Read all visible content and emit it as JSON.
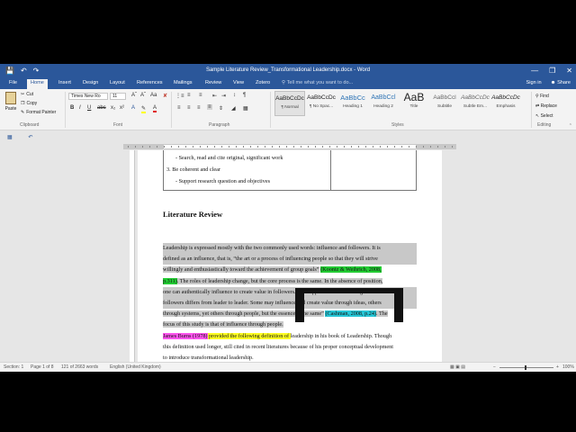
{
  "window": {
    "title": "Sample Literature Review_Transformational Leadership.docx - Word",
    "buttons": [
      "—",
      "❐",
      "✕"
    ]
  },
  "qat": {
    "save": "💾",
    "undo": "↶",
    "redo": "↷"
  },
  "tabs": [
    "File",
    "Home",
    "Insert",
    "Design",
    "Layout",
    "References",
    "Mailings",
    "Review",
    "View",
    "Zotero"
  ],
  "tell_me": "Tell me what you want to do...",
  "account": {
    "signin": "Sign in",
    "share": "Share"
  },
  "ribbon": {
    "clipboard": {
      "paste": "Paste",
      "cut": "Cut",
      "copy": "Copy",
      "format_painter": "Format Painter",
      "label": "Clipboard"
    },
    "font": {
      "name": "Times New Ro",
      "size": "11",
      "label": "Font"
    },
    "paragraph": {
      "label": "Paragraph"
    },
    "styles": {
      "label": "Styles",
      "items": [
        {
          "sample": "AaBbCcDc",
          "name": "¶ Normal"
        },
        {
          "sample": "AaBbCcDc",
          "name": "¶ No Spac..."
        },
        {
          "sample": "AaBbCc",
          "name": "Heading 1"
        },
        {
          "sample": "AaBbCcl",
          "name": "Heading 2"
        },
        {
          "sample": "AaB",
          "name": "Title"
        },
        {
          "sample": "AaBbCcl",
          "name": "Subtitle"
        },
        {
          "sample": "AaBbCcDc",
          "name": "Subtle Em..."
        },
        {
          "sample": "AaBbCcDc",
          "name": "Emphasis"
        }
      ]
    },
    "editing": {
      "find": "Find",
      "replace": "Replace",
      "select": "Select",
      "label": "Editing"
    }
  },
  "document": {
    "table_lines": [
      "- Search, read and cite original, significant work",
      "3.  Be coherent and clear",
      "- Support research question and objectives"
    ],
    "heading": "Literature Review",
    "para1": {
      "l1": "Leadership is expressed mostly with the two commonly used words: influence and followers. It is",
      "l2": "defined as an influence, that is, “the art or a process of influencing people so that they will strive",
      "l3a": "willingly and enthusiastically toward the achievement of group goals”",
      "l3b": "(Koontz & Weihrich, 2008,",
      "l4a": "p.311)",
      "l4b": ". The roles of leadership change, but the core process is the same. In the absence of position,",
      "l5": "one can authentically influence to create value in followers. “The approach of influencing their",
      "l6": "followers differs from leader to leader. Some may influence and create value through ideas, others",
      "l7a": "through systems, yet others through people, but the essence is the same”",
      "l7b": "(Cashman, 2008, p.24)",
      "l7c": ". The",
      "l8": "focus of this study is that of influence through people."
    },
    "para2": {
      "l1a": "James Burns (1978)",
      "l1b": " provided the following definition of ",
      "l1c": "leadership in his book of ",
      "l1d": "Leadership. Though",
      "l2": "this definition used longer, still cited in recent literatures because of his proper conceptual development",
      "l3": "to introduce transformational leadership."
    }
  },
  "status": {
    "section": "Section: 1",
    "page": "Page 1 of 8",
    "words": "121 of 2663 words",
    "language": "English (United Kingdom)",
    "zoom": "100%"
  }
}
